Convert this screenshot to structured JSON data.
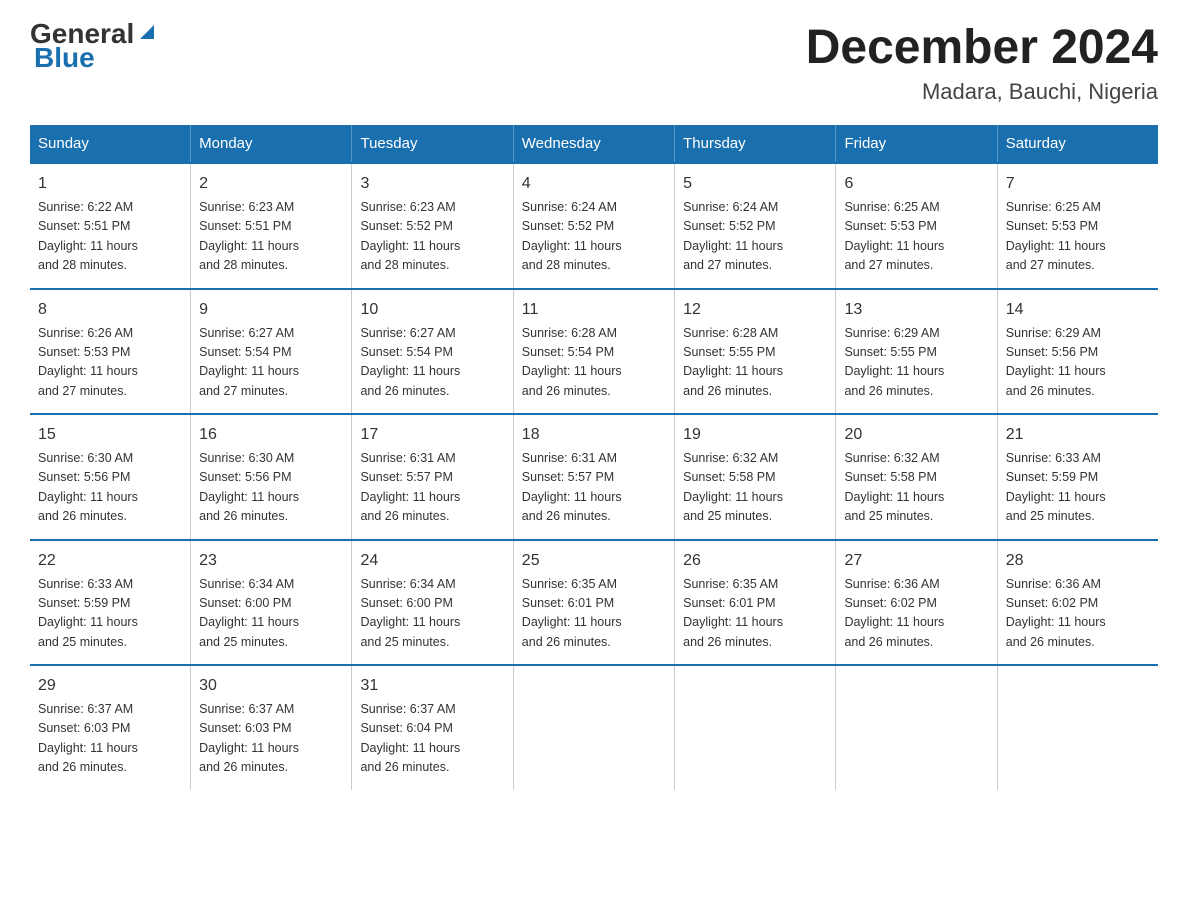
{
  "header": {
    "logo_general": "General",
    "logo_blue": "Blue",
    "title": "December 2024",
    "subtitle": "Madara, Bauchi, Nigeria"
  },
  "days_of_week": [
    "Sunday",
    "Monday",
    "Tuesday",
    "Wednesday",
    "Thursday",
    "Friday",
    "Saturday"
  ],
  "weeks": [
    [
      {
        "day": "1",
        "info": "Sunrise: 6:22 AM\nSunset: 5:51 PM\nDaylight: 11 hours\nand 28 minutes."
      },
      {
        "day": "2",
        "info": "Sunrise: 6:23 AM\nSunset: 5:51 PM\nDaylight: 11 hours\nand 28 minutes."
      },
      {
        "day": "3",
        "info": "Sunrise: 6:23 AM\nSunset: 5:52 PM\nDaylight: 11 hours\nand 28 minutes."
      },
      {
        "day": "4",
        "info": "Sunrise: 6:24 AM\nSunset: 5:52 PM\nDaylight: 11 hours\nand 28 minutes."
      },
      {
        "day": "5",
        "info": "Sunrise: 6:24 AM\nSunset: 5:52 PM\nDaylight: 11 hours\nand 27 minutes."
      },
      {
        "day": "6",
        "info": "Sunrise: 6:25 AM\nSunset: 5:53 PM\nDaylight: 11 hours\nand 27 minutes."
      },
      {
        "day": "7",
        "info": "Sunrise: 6:25 AM\nSunset: 5:53 PM\nDaylight: 11 hours\nand 27 minutes."
      }
    ],
    [
      {
        "day": "8",
        "info": "Sunrise: 6:26 AM\nSunset: 5:53 PM\nDaylight: 11 hours\nand 27 minutes."
      },
      {
        "day": "9",
        "info": "Sunrise: 6:27 AM\nSunset: 5:54 PM\nDaylight: 11 hours\nand 27 minutes."
      },
      {
        "day": "10",
        "info": "Sunrise: 6:27 AM\nSunset: 5:54 PM\nDaylight: 11 hours\nand 26 minutes."
      },
      {
        "day": "11",
        "info": "Sunrise: 6:28 AM\nSunset: 5:54 PM\nDaylight: 11 hours\nand 26 minutes."
      },
      {
        "day": "12",
        "info": "Sunrise: 6:28 AM\nSunset: 5:55 PM\nDaylight: 11 hours\nand 26 minutes."
      },
      {
        "day": "13",
        "info": "Sunrise: 6:29 AM\nSunset: 5:55 PM\nDaylight: 11 hours\nand 26 minutes."
      },
      {
        "day": "14",
        "info": "Sunrise: 6:29 AM\nSunset: 5:56 PM\nDaylight: 11 hours\nand 26 minutes."
      }
    ],
    [
      {
        "day": "15",
        "info": "Sunrise: 6:30 AM\nSunset: 5:56 PM\nDaylight: 11 hours\nand 26 minutes."
      },
      {
        "day": "16",
        "info": "Sunrise: 6:30 AM\nSunset: 5:56 PM\nDaylight: 11 hours\nand 26 minutes."
      },
      {
        "day": "17",
        "info": "Sunrise: 6:31 AM\nSunset: 5:57 PM\nDaylight: 11 hours\nand 26 minutes."
      },
      {
        "day": "18",
        "info": "Sunrise: 6:31 AM\nSunset: 5:57 PM\nDaylight: 11 hours\nand 26 minutes."
      },
      {
        "day": "19",
        "info": "Sunrise: 6:32 AM\nSunset: 5:58 PM\nDaylight: 11 hours\nand 25 minutes."
      },
      {
        "day": "20",
        "info": "Sunrise: 6:32 AM\nSunset: 5:58 PM\nDaylight: 11 hours\nand 25 minutes."
      },
      {
        "day": "21",
        "info": "Sunrise: 6:33 AM\nSunset: 5:59 PM\nDaylight: 11 hours\nand 25 minutes."
      }
    ],
    [
      {
        "day": "22",
        "info": "Sunrise: 6:33 AM\nSunset: 5:59 PM\nDaylight: 11 hours\nand 25 minutes."
      },
      {
        "day": "23",
        "info": "Sunrise: 6:34 AM\nSunset: 6:00 PM\nDaylight: 11 hours\nand 25 minutes."
      },
      {
        "day": "24",
        "info": "Sunrise: 6:34 AM\nSunset: 6:00 PM\nDaylight: 11 hours\nand 25 minutes."
      },
      {
        "day": "25",
        "info": "Sunrise: 6:35 AM\nSunset: 6:01 PM\nDaylight: 11 hours\nand 26 minutes."
      },
      {
        "day": "26",
        "info": "Sunrise: 6:35 AM\nSunset: 6:01 PM\nDaylight: 11 hours\nand 26 minutes."
      },
      {
        "day": "27",
        "info": "Sunrise: 6:36 AM\nSunset: 6:02 PM\nDaylight: 11 hours\nand 26 minutes."
      },
      {
        "day": "28",
        "info": "Sunrise: 6:36 AM\nSunset: 6:02 PM\nDaylight: 11 hours\nand 26 minutes."
      }
    ],
    [
      {
        "day": "29",
        "info": "Sunrise: 6:37 AM\nSunset: 6:03 PM\nDaylight: 11 hours\nand 26 minutes."
      },
      {
        "day": "30",
        "info": "Sunrise: 6:37 AM\nSunset: 6:03 PM\nDaylight: 11 hours\nand 26 minutes."
      },
      {
        "day": "31",
        "info": "Sunrise: 6:37 AM\nSunset: 6:04 PM\nDaylight: 11 hours\nand 26 minutes."
      },
      {
        "day": "",
        "info": ""
      },
      {
        "day": "",
        "info": ""
      },
      {
        "day": "",
        "info": ""
      },
      {
        "day": "",
        "info": ""
      }
    ]
  ]
}
